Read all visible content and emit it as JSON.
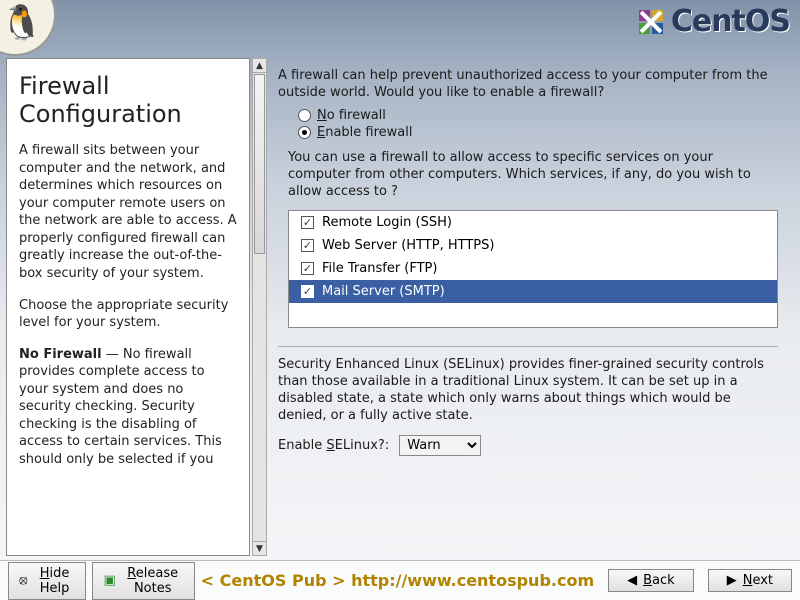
{
  "brand": "CentOS",
  "help": {
    "title": "Firewall Configuration",
    "p1": "A firewall sits between your computer and the network, and determines which resources on your computer remote users on the network are able to access. A properly configured firewall can greatly increase the out-of-the-box security of your system.",
    "p2": "Choose the appropriate security level for your system.",
    "p3_label": "No Firewall",
    "p3_rest": " — No firewall provides complete access to your system and does no security checking. Security checking is the disabling of access to certain services. This should only be selected if you"
  },
  "firewall": {
    "intro": "A firewall can help prevent unauthorized access to your computer from the outside world.  Would you like to enable a firewall?",
    "options": {
      "no": "No firewall",
      "enable": "Enable firewall"
    },
    "selected": "enable"
  },
  "services": {
    "intro": "You can use a firewall to allow access to specific services on your computer from other computers. Which services, if any, do you wish to allow access to ?",
    "items": [
      {
        "label": "Remote Login (SSH)",
        "checked": true,
        "selected": false
      },
      {
        "label": "Web Server (HTTP, HTTPS)",
        "checked": true,
        "selected": false
      },
      {
        "label": "File Transfer (FTP)",
        "checked": true,
        "selected": false
      },
      {
        "label": "Mail Server (SMTP)",
        "checked": true,
        "selected": true
      }
    ]
  },
  "selinux": {
    "intro": "Security Enhanced Linux (SELinux) provides finer-grained security controls than those available in a traditional Linux system.  It can be set up in a disabled state, a state which only warns about things which would be denied, or a fully active state.",
    "label_pre": "Enable ",
    "label_u": "S",
    "label_post": "ELinux?:",
    "value": "Warn"
  },
  "footer": {
    "hide_help": "Hide Help",
    "release_notes": "Release Notes",
    "back": "Back",
    "next": "Next",
    "watermark": "< CentOS Pub >  http://www.centospub.com"
  }
}
